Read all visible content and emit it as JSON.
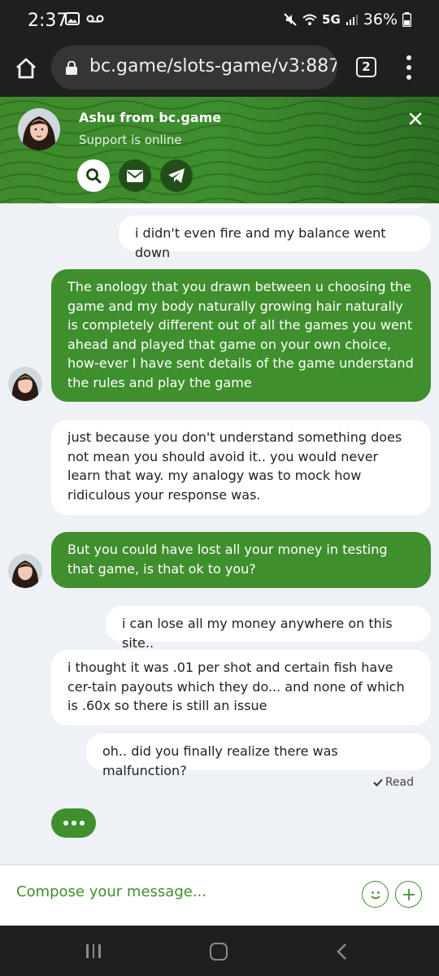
{
  "status_bar": {
    "time": "2:37",
    "network": "5G",
    "battery": "36%"
  },
  "browser": {
    "url": "bc.game/slots-game/v3:887",
    "tab_count": "2"
  },
  "chat_header": {
    "agent_name": "Ashu from bc.game",
    "agent_status": "Support is online",
    "icons": [
      "search-icon",
      "email-icon",
      "telegram-icon"
    ]
  },
  "messages": [
    {
      "sender": "user",
      "text": "i didn't even fire and my balance went down"
    },
    {
      "sender": "agent",
      "text": "The anology that you drawn between u choosing the game and my body naturally growing hair naturally is completely different out of all the games you went ahead and played that game on your own choice, how-ever I have sent details of the game understand the rules and play the game"
    },
    {
      "sender": "user",
      "text": "just because you don't understand something does not mean you should avoid it.. you would never learn that way. my analogy was to mock how ridiculous your response was."
    },
    {
      "sender": "agent",
      "text": "But you could have lost all your money in testing that game, is that ok to you?"
    },
    {
      "sender": "user",
      "text": "i can lose all my money anywhere on this site.."
    },
    {
      "sender": "user",
      "text": "i thought it was .01 per shot and certain fish have cer-tain payouts which they do... and none of which is .60x so there is still an issue"
    },
    {
      "sender": "user",
      "text": "oh.. did you finally realize there was malfunction?"
    }
  ],
  "read_receipt": "Read",
  "composer": {
    "placeholder": "Compose your message..."
  },
  "colors": {
    "brand_green": "#3f8f2e",
    "header_dark_green": "#224f18",
    "chat_bg": "#eef1f6"
  }
}
